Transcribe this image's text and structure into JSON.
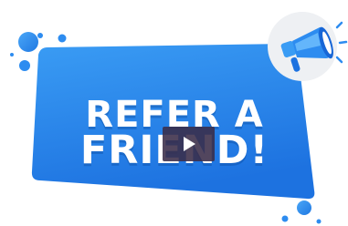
{
  "banner": {
    "line_1": "REFER A",
    "line_2": "FRIEND!"
  },
  "video": {
    "play_label": "Play"
  },
  "colors": {
    "banner_blue": "#2f8ff0",
    "banner_blue_dark": "#1766d6",
    "dot_blue": "#2d8cf0",
    "circle_grey": "#eef0f3",
    "text_white": "#ffffff",
    "play_overlay": "#3a2c48"
  },
  "icons": {
    "megaphone": "megaphone-icon",
    "play": "play-icon"
  }
}
